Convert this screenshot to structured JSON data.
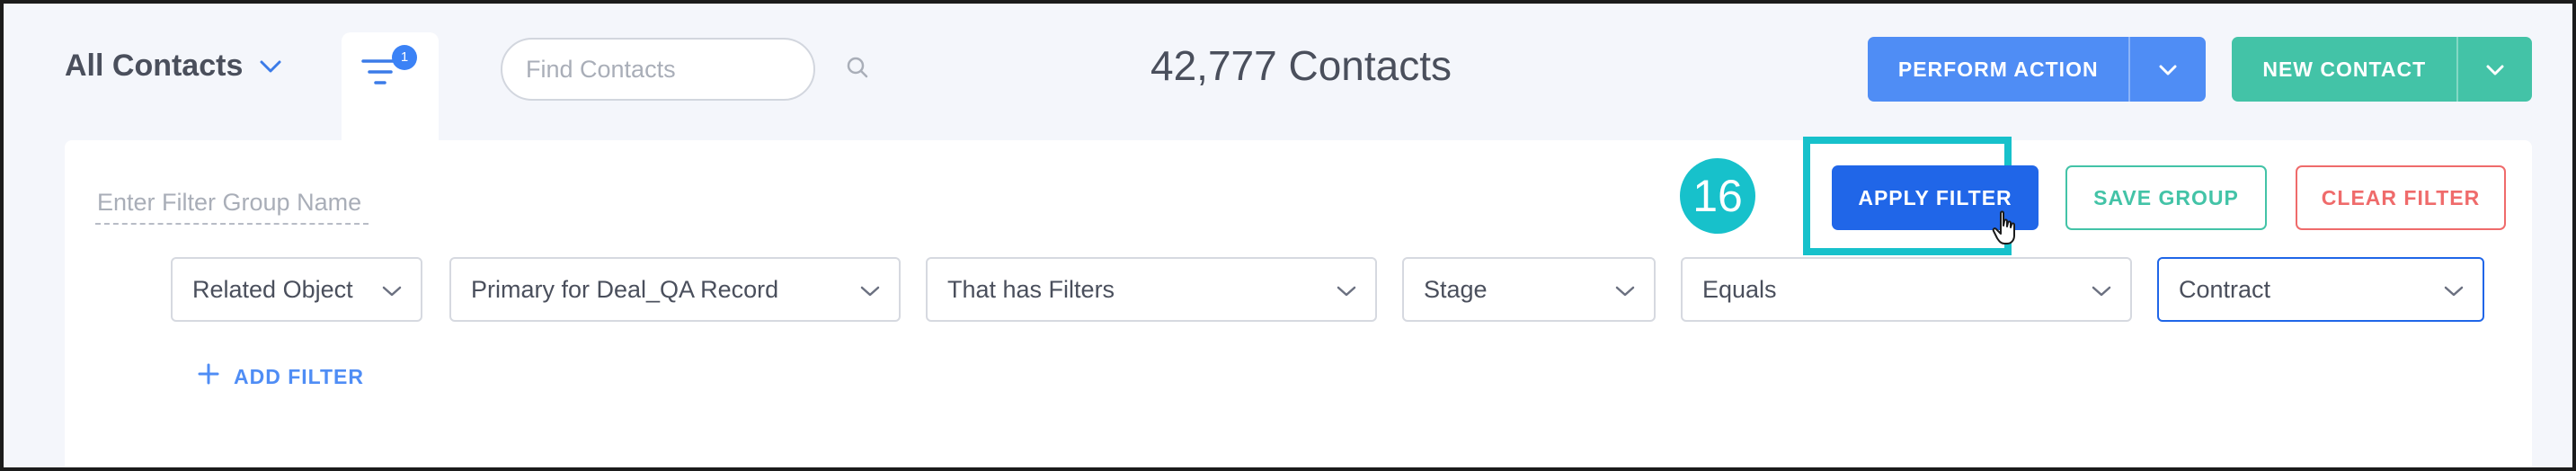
{
  "header": {
    "view_selector": "All Contacts",
    "filter_badge_count": "1",
    "search_placeholder": "Find Contacts",
    "contacts_count": "42,777 Contacts",
    "perform_action_label": "PERFORM ACTION",
    "new_contact_label": "NEW CONTACT"
  },
  "filter_panel": {
    "group_name_placeholder": "Enter Filter Group Name",
    "step_number": "16",
    "apply_filter_label": "APPLY FILTER",
    "save_group_label": "SAVE GROUP",
    "clear_filter_label": "CLEAR FILTER",
    "filters": [
      {
        "value": "Related Object"
      },
      {
        "value": "Primary for Deal_QA Record"
      },
      {
        "value": "That has Filters"
      },
      {
        "value": "Stage"
      },
      {
        "value": "Equals"
      },
      {
        "value": "Contract"
      }
    ],
    "add_filter_label": "ADD FILTER"
  },
  "colors": {
    "primary_blue": "#2066e8",
    "perform_blue": "#4f8df5",
    "teal": "#43c3a7",
    "red": "#ef6b6b",
    "highlight_cyan": "#17c1cb"
  },
  "icons": [
    "chevron-down-icon",
    "filter-icon",
    "search-icon",
    "plus-icon",
    "hand-pointer-icon"
  ]
}
